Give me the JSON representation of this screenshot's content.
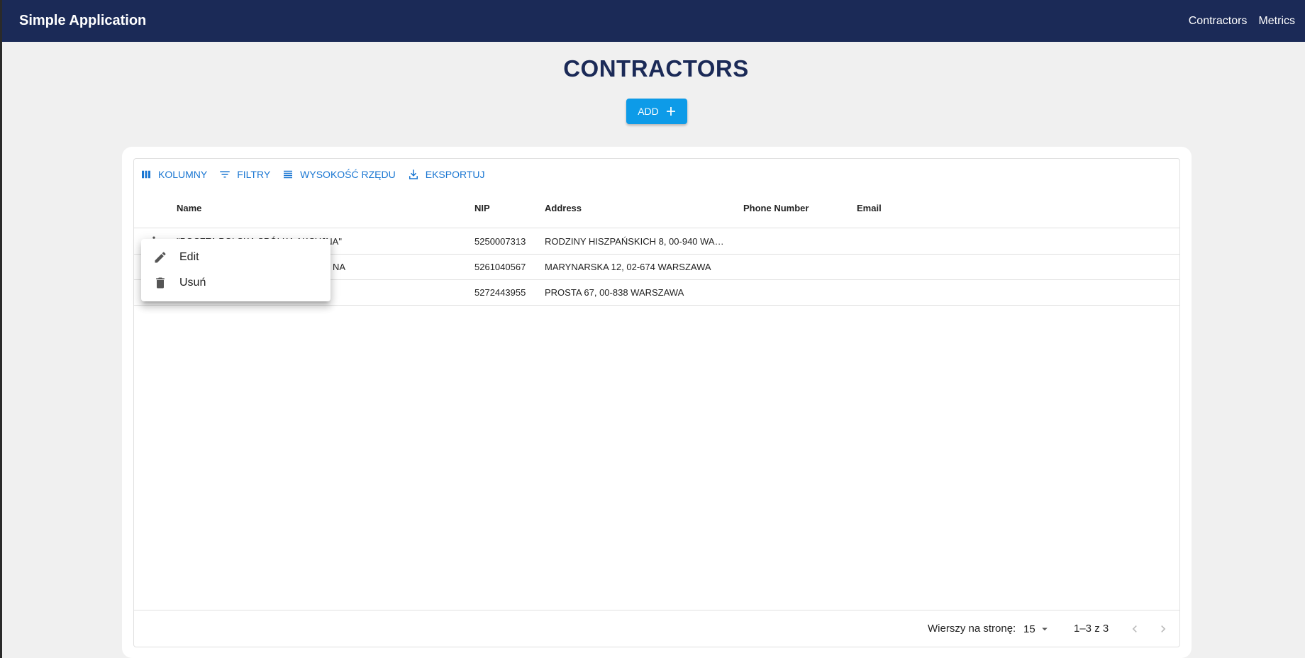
{
  "app": {
    "title": "Simple Application"
  },
  "nav": {
    "items": [
      "Contractors",
      "Metrics"
    ]
  },
  "page": {
    "title": "CONTRACTORS",
    "add_label": "ADD"
  },
  "toolbar": {
    "columns": "KOLUMNY",
    "filters": "FILTRY",
    "density": "WYSOKOŚĆ RZĘDU",
    "export": "EKSPORTUJ"
  },
  "table": {
    "columns": [
      "Name",
      "NIP",
      "Address",
      "Phone Number",
      "Email"
    ],
    "rows": [
      {
        "name": "\"POCZTA POLSKA SPÓŁKA AKCYJNA\"",
        "nip": "5250007313",
        "address": "RODZINY HISZPAŃSKICH 8, 00-940 WA…",
        "phone": "",
        "email": ""
      },
      {
        "name": "NA",
        "nip": "5261040567",
        "address": "MARYNARSKA 12, 02-674 WARSZAWA",
        "phone": "",
        "email": ""
      },
      {
        "name": "",
        "nip": "5272443955",
        "address": "PROSTA 67, 00-838 WARSZAWA",
        "phone": "",
        "email": ""
      }
    ]
  },
  "context_menu": {
    "edit": "Edit",
    "delete": "Usuń"
  },
  "pagination": {
    "rows_per_page_label": "Wierszy na stronę:",
    "rows_per_page": "15",
    "range": "1–3 z 3"
  }
}
